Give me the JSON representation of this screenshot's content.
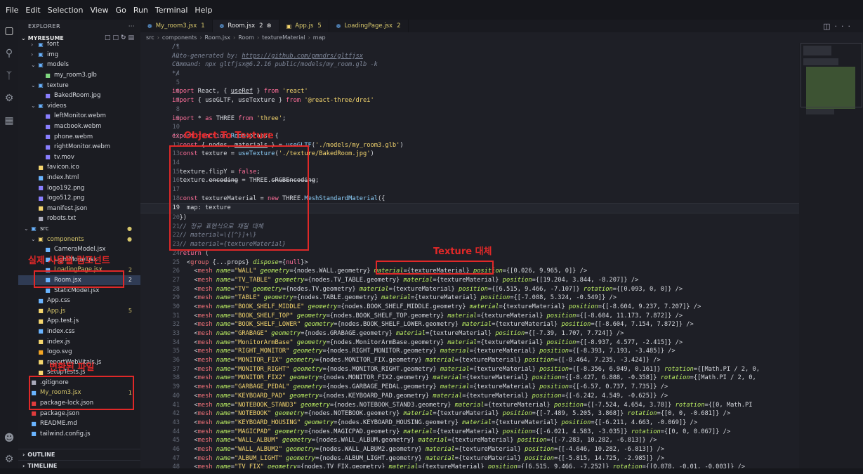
{
  "menu": [
    "File",
    "Edit",
    "Selection",
    "View",
    "Go",
    "Run",
    "Terminal",
    "Help"
  ],
  "explorer": {
    "title": "EXPLORER",
    "project": "MYRESUME",
    "tree": [
      {
        "label": "font",
        "depth": 1,
        "kind": "folder",
        "open": false,
        "color": "#6ab4ff"
      },
      {
        "label": "img",
        "depth": 1,
        "kind": "folder",
        "open": false,
        "color": "#6ab4ff"
      },
      {
        "label": "models",
        "depth": 1,
        "kind": "folder",
        "open": true,
        "color": "#6ab4ff"
      },
      {
        "label": "my_room3.glb",
        "depth": 2,
        "kind": "file",
        "color": "#7fd77f"
      },
      {
        "label": "texture",
        "depth": 1,
        "kind": "folder",
        "open": true,
        "color": "#6ab4ff"
      },
      {
        "label": "BakedRoom.jpg",
        "depth": 2,
        "kind": "file",
        "color": "#8a7fff"
      },
      {
        "label": "videos",
        "depth": 1,
        "kind": "folder",
        "open": true,
        "color": "#6ab4ff"
      },
      {
        "label": "leftMonitor.webm",
        "depth": 2,
        "kind": "file",
        "color": "#8a7fff"
      },
      {
        "label": "macbook.webm",
        "depth": 2,
        "kind": "file",
        "color": "#8a7fff"
      },
      {
        "label": "phone.webm",
        "depth": 2,
        "kind": "file",
        "color": "#8a7fff"
      },
      {
        "label": "rightMonitor.webm",
        "depth": 2,
        "kind": "file",
        "color": "#8a7fff"
      },
      {
        "label": "tv.mov",
        "depth": 2,
        "kind": "file",
        "color": "#8a7fff"
      },
      {
        "label": "favicon.ico",
        "depth": 1,
        "kind": "file",
        "color": "#f5d66e"
      },
      {
        "label": "index.html",
        "depth": 1,
        "kind": "file",
        "color": "#6ab4ff"
      },
      {
        "label": "logo192.png",
        "depth": 1,
        "kind": "file",
        "color": "#8a7fff"
      },
      {
        "label": "logo512.png",
        "depth": 1,
        "kind": "file",
        "color": "#8a7fff"
      },
      {
        "label": "manifest.json",
        "depth": 1,
        "kind": "file",
        "color": "#f5d66e"
      },
      {
        "label": "robots.txt",
        "depth": 1,
        "kind": "file",
        "color": "#aab"
      },
      {
        "label": "src",
        "depth": 0,
        "kind": "folder",
        "open": true,
        "color": "#6ab4ff",
        "dot": "#d6c66b"
      },
      {
        "label": "components",
        "depth": 1,
        "kind": "folder",
        "open": true,
        "color": "#f5d66e",
        "labelColor": "#d6c66b",
        "dot": "#d6c66b"
      },
      {
        "label": "CameraModel.jsx",
        "depth": 2,
        "kind": "file",
        "color": "#6ab4ff"
      },
      {
        "label": "LightModel.jsx",
        "depth": 2,
        "kind": "file",
        "color": "#6ab4ff"
      },
      {
        "label": "LoadingPage.jsx",
        "depth": 2,
        "kind": "file",
        "color": "#6ab4ff",
        "labelColor": "#d6c66b",
        "badge": "2",
        "badgeColor": "#d6c66b"
      },
      {
        "label": "Room.jsx",
        "depth": 2,
        "kind": "file",
        "color": "#6ab4ff",
        "selected": true,
        "badge": "2",
        "badgeColor": "#e6e6e6"
      },
      {
        "label": "StaticModel.jsx",
        "depth": 2,
        "kind": "file",
        "color": "#6ab4ff"
      },
      {
        "label": "App.css",
        "depth": 1,
        "kind": "file",
        "color": "#6ab4ff"
      },
      {
        "label": "App.js",
        "depth": 1,
        "kind": "file",
        "color": "#f5d66e",
        "labelColor": "#d6c66b",
        "badge": "5",
        "badgeColor": "#d6c66b"
      },
      {
        "label": "App.test.js",
        "depth": 1,
        "kind": "file",
        "color": "#f5d66e"
      },
      {
        "label": "index.css",
        "depth": 1,
        "kind": "file",
        "color": "#6ab4ff"
      },
      {
        "label": "index.js",
        "depth": 1,
        "kind": "file",
        "color": "#f5d66e"
      },
      {
        "label": "logo.svg",
        "depth": 1,
        "kind": "file",
        "color": "#f5a623"
      },
      {
        "label": "reportWebVitals.js",
        "depth": 1,
        "kind": "file",
        "color": "#f5d66e"
      },
      {
        "label": "setupTests.js",
        "depth": 1,
        "kind": "file",
        "color": "#f5d66e"
      },
      {
        "label": ".gitignore",
        "depth": 0,
        "kind": "file",
        "color": "#aab"
      },
      {
        "label": "My_room3.jsx",
        "depth": 0,
        "kind": "file",
        "color": "#6ab4ff",
        "labelColor": "#d6c66b",
        "badge": "1",
        "badgeColor": "#d6c66b"
      },
      {
        "label": "package-lock.json",
        "depth": 0,
        "kind": "file",
        "color": "#e03c3c"
      },
      {
        "label": "package.json",
        "depth": 0,
        "kind": "file",
        "color": "#e03c3c"
      },
      {
        "label": "README.md",
        "depth": 0,
        "kind": "file",
        "color": "#6ab4ff"
      },
      {
        "label": "tailwind.config.js",
        "depth": 0,
        "kind": "file",
        "color": "#6ab4ff"
      }
    ],
    "outline": "OUTLINE",
    "timeline": "TIMELINE"
  },
  "tabs": [
    {
      "label": "My_room3.jsx",
      "count": "1",
      "active": false
    },
    {
      "label": "Room.jsx",
      "count": "2",
      "active": true
    },
    {
      "label": "App.js",
      "count": "5",
      "active": false
    },
    {
      "label": "LoadingPage.jsx",
      "count": "2",
      "active": false
    }
  ],
  "breadcrumb": [
    "src",
    "components",
    "Room.jsx",
    "Room",
    "textureMaterial",
    "map"
  ],
  "code_lines": [
    {
      "n": "1",
      "html": "<span class='c-cmt'>/*</span>"
    },
    {
      "n": "2",
      "html": "<span class='c-cmt'>Auto-generated by: </span><span class='c-link'>https://github.com/pmndrs/gltfjsx</span>"
    },
    {
      "n": "3",
      "html": "<span class='c-cmt'>Command: npx gltfjsx@6.2.16 public/models/my_room.glb -k</span>"
    },
    {
      "n": "4",
      "html": "<span class='c-cmt'>*/</span>"
    },
    {
      "n": "5",
      "html": ""
    },
    {
      "n": "6",
      "html": "<span class='c-kw'>import</span> React, { <u>useRef</u> } <span class='c-kw'>from</span> <span class='c-str'>'react'</span>"
    },
    {
      "n": "7",
      "html": "<span class='c-kw'>import</span> { useGLTF, useTexture } <span class='c-kw'>from</span> <span class='c-str'>'@react-three/drei'</span>"
    },
    {
      "n": "8",
      "html": ""
    },
    {
      "n": "9",
      "html": "<span class='c-kw'>import</span> * <span class='c-kw'>as</span> THREE <span class='c-kw'>from</span> <span class='c-str'>'three'</span>;"
    },
    {
      "n": "10",
      "html": ""
    },
    {
      "n": "11",
      "html": "<span class='c-kw'>export function</span> <span class='c-fn'>Room</span>(props) {"
    },
    {
      "n": "12",
      "html": "  <span class='c-kw'>const</span> { nodes, <u>materials</u> } = <span class='c-fn'>useGLTF</span>(<span class='c-str'>'./models/my_room3.glb'</span>)"
    },
    {
      "n": "13",
      "html": "  <span class='c-kw'>const</span> texture = <span class='c-fn'>useTexture</span>(<span class='c-str'>'./texture/BakedRoom.jpg'</span>)"
    },
    {
      "n": "14",
      "html": ""
    },
    {
      "n": "15",
      "html": "  texture.flipY = <span class='c-kw'>false</span>;"
    },
    {
      "n": "16",
      "html": "  texture.<s>encoding</s> = THREE.<s>sRGBEncoding</s>;"
    },
    {
      "n": "17",
      "html": ""
    },
    {
      "n": "18",
      "html": "  <span class='c-kw'>const</span> textureMaterial = <span class='c-kw'>new</span> THREE.<span class='c-fn'>MeshStandardMaterial</span>({"
    },
    {
      "n": "19",
      "html": "    map: texture"
    },
    {
      "n": "20",
      "html": "  })"
    },
    {
      "n": "21",
      "html": "  <span class='c-cmt'>// 정규 표현식으로 재질 대체</span>"
    },
    {
      "n": "22",
      "html": "  <span class='c-cmt'>// material=\\{[^}]+\\}</span>"
    },
    {
      "n": "23",
      "html": "  <span class='c-cmt'>// material={textureMaterial}</span>"
    },
    {
      "n": "24",
      "html": "  <span class='c-kw'>return</span> ("
    },
    {
      "n": "25",
      "html": "    &lt;<span class='c-tag'>group</span> {...props} <span class='c-attr'>dispose</span>={<span class='c-kw'>null</span>}&gt;"
    },
    {
      "n": "26",
      "html": "      &lt;<span class='c-tag'>mesh</span> <span class='c-attr'>name</span>=<span class='c-str'>\"WALL\"</span> <span class='c-attr'>geometry</span>={nodes.WALL.geometry} <span class='c-attr'>material</span>={textureMaterial} <span class='c-attr'>position</span>={[0.026, 9.965, 0]} /&gt;"
    },
    {
      "n": "27",
      "html": "      &lt;<span class='c-tag'>mesh</span> <span class='c-attr'>name</span>=<span class='c-str'>\"TV_TABLE\"</span> <span class='c-attr'>geometry</span>={nodes.TV_TABLE.geometry} <span class='c-attr'>material</span>={textureMaterial} <span class='c-attr'>position</span>={[19.204, 3.844, -8.207]} /&gt;"
    },
    {
      "n": "28",
      "html": "      &lt;<span class='c-tag'>mesh</span> <span class='c-attr'>name</span>=<span class='c-str'>\"TV\"</span> <span class='c-attr'>geometry</span>={nodes.TV.geometry} <span class='c-attr'>material</span>={textureMaterial} <span class='c-attr'>position</span>={[6.515, 9.466, -7.107]} <span class='c-attr'>rotation</span>={[0.093, 0, 0]} /&gt;"
    },
    {
      "n": "29",
      "html": "      &lt;<span class='c-tag'>mesh</span> <span class='c-attr'>name</span>=<span class='c-str'>\"TABLE\"</span> <span class='c-attr'>geometry</span>={nodes.TABLE.geometry} <span class='c-attr'>material</span>={textureMaterial} <span class='c-attr'>position</span>={[-7.088, 5.324, -0.549]} /&gt;"
    },
    {
      "n": "30",
      "html": "      &lt;<span class='c-tag'>mesh</span> <span class='c-attr'>name</span>=<span class='c-str'>\"BOOK_SHELF_MIDDLE\"</span> <span class='c-attr'>geometry</span>={nodes.BOOK_SHELF_MIDDLE.geometry} <span class='c-attr'>material</span>={textureMaterial} <span class='c-attr'>position</span>={[-8.604, 9.237, 7.207]} /&gt;"
    },
    {
      "n": "31",
      "html": "      &lt;<span class='c-tag'>mesh</span> <span class='c-attr'>name</span>=<span class='c-str'>\"BOOK_SHELF_TOP\"</span> <span class='c-attr'>geometry</span>={nodes.BOOK_SHELF_TOP.geometry} <span class='c-attr'>material</span>={textureMaterial} <span class='c-attr'>position</span>={[-8.604, 11.173, 7.872]} /&gt;"
    },
    {
      "n": "32",
      "html": "      &lt;<span class='c-tag'>mesh</span> <span class='c-attr'>name</span>=<span class='c-str'>\"BOOK_SHELF_LOWER\"</span> <span class='c-attr'>geometry</span>={nodes.BOOK_SHELF_LOWER.geometry} <span class='c-attr'>material</span>={textureMaterial} <span class='c-attr'>position</span>={[-8.604, 7.154, 7.872]} /&gt;"
    },
    {
      "n": "33",
      "html": "      &lt;<span class='c-tag'>mesh</span> <span class='c-attr'>name</span>=<span class='c-str'>\"GRABAGE\"</span> <span class='c-attr'>geometry</span>={nodes.GRABAGE.geometry} <span class='c-attr'>material</span>={textureMaterial} <span class='c-attr'>position</span>={[-7.39, 1.707, 7.724]} /&gt;"
    },
    {
      "n": "34",
      "html": "      &lt;<span class='c-tag'>mesh</span> <span class='c-attr'>name</span>=<span class='c-str'>\"MonitorArmBase\"</span> <span class='c-attr'>geometry</span>={nodes.MonitorArmBase.geometry} <span class='c-attr'>material</span>={textureMaterial} <span class='c-attr'>position</span>={[-8.937, 4.577, -2.415]} /&gt;"
    },
    {
      "n": "35",
      "html": "      &lt;<span class='c-tag'>mesh</span> <span class='c-attr'>name</span>=<span class='c-str'>\"RIGHT_MONITOR\"</span> <span class='c-attr'>geometry</span>={nodes.RIGHT_MONITOR.geometry} <span class='c-attr'>material</span>={textureMaterial} <span class='c-attr'>position</span>={[-8.393, 7.193, -3.485]} /&gt;"
    },
    {
      "n": "36",
      "html": "      &lt;<span class='c-tag'>mesh</span> <span class='c-attr'>name</span>=<span class='c-str'>\"MONITOR_FIX\"</span> <span class='c-attr'>geometry</span>={nodes.MONITOR_FIX.geometry} <span class='c-attr'>material</span>={textureMaterial} <span class='c-attr'>position</span>={[-8.464, 7.235, -3.424]} /&gt;"
    },
    {
      "n": "37",
      "html": "      &lt;<span class='c-tag'>mesh</span> <span class='c-attr'>name</span>=<span class='c-str'>\"MONITOR_RIGHT\"</span> <span class='c-attr'>geometry</span>={nodes.MONITOR_RIGHT.geometry} <span class='c-attr'>material</span>={textureMaterial} <span class='c-attr'>position</span>={[-8.356, 6.949, 0.161]} <span class='c-attr'>rotation</span>={[Math.PI / 2, 0,"
    },
    {
      "n": "38",
      "html": "      &lt;<span class='c-tag'>mesh</span> <span class='c-attr'>name</span>=<span class='c-str'>\"MONITOR_FIX2\"</span> <span class='c-attr'>geometry</span>={nodes.MONITOR_FIX2.geometry} <span class='c-attr'>material</span>={textureMaterial} <span class='c-attr'>position</span>={[-8.427, 6.888, -0.358]} <span class='c-attr'>rotation</span>={[Math.PI / 2, 0,"
    },
    {
      "n": "39",
      "html": "      &lt;<span class='c-tag'>mesh</span> <span class='c-attr'>name</span>=<span class='c-str'>\"GARBAGE_PEDAL\"</span> <span class='c-attr'>geometry</span>={nodes.GARBAGE_PEDAL.geometry} <span class='c-attr'>material</span>={textureMaterial} <span class='c-attr'>position</span>={[-6.57, 0.737, 7.735]} /&gt;"
    },
    {
      "n": "40",
      "html": "      &lt;<span class='c-tag'>mesh</span> <span class='c-attr'>name</span>=<span class='c-str'>\"KEYBOARD_PAD\"</span> <span class='c-attr'>geometry</span>={nodes.KEYBOARD_PAD.geometry} <span class='c-attr'>material</span>={textureMaterial} <span class='c-attr'>position</span>={[-6.242, 4.549, -0.625]} /&gt;"
    },
    {
      "n": "41",
      "html": "      &lt;<span class='c-tag'>mesh</span> <span class='c-attr'>name</span>=<span class='c-str'>\"NOTEBOOK_STAND3\"</span> <span class='c-attr'>geometry</span>={nodes.NOTEBOOK_STAND3.geometry} <span class='c-attr'>material</span>={textureMaterial} <span class='c-attr'>position</span>={[-7.524, 4.654, 3.78]} <span class='c-attr'>rotation</span>={[0, Math.PI"
    },
    {
      "n": "42",
      "html": "      &lt;<span class='c-tag'>mesh</span> <span class='c-attr'>name</span>=<span class='c-str'>\"NOTEBOOK\"</span> <span class='c-attr'>geometry</span>={nodes.NOTEBOOK.geometry} <span class='c-attr'>material</span>={textureMaterial} <span class='c-attr'>position</span>={[-7.489, 5.205, 3.868]} <span class='c-attr'>rotation</span>={[0, 0, -0.681]} /&gt;"
    },
    {
      "n": "43",
      "html": "      &lt;<span class='c-tag'>mesh</span> <span class='c-attr'>name</span>=<span class='c-str'>\"KEYBOARD_HOUSING\"</span> <span class='c-attr'>geometry</span>={nodes.KEYBOARD_HOUSING.geometry} <span class='c-attr'>material</span>={textureMaterial} <span class='c-attr'>position</span>={[-6.211, 4.663, -0.069]} /&gt;"
    },
    {
      "n": "44",
      "html": "      &lt;<span class='c-tag'>mesh</span> <span class='c-attr'>name</span>=<span class='c-str'>\"MAGICPAD\"</span> <span class='c-attr'>geometry</span>={nodes.MAGICPAD.geometry} <span class='c-attr'>material</span>={textureMaterial} <span class='c-attr'>position</span>={[-6.021, 4.583, -3.035]} <span class='c-attr'>rotation</span>={[0, 0, 0.067]} /&gt;"
    },
    {
      "n": "45",
      "html": "      &lt;<span class='c-tag'>mesh</span> <span class='c-attr'>name</span>=<span class='c-str'>\"WALL_ALBUM\"</span> <span class='c-attr'>geometry</span>={nodes.WALL_ALBUM.geometry} <span class='c-attr'>material</span>={textureMaterial} <span class='c-attr'>position</span>={[-7.283, 10.282, -6.813]} /&gt;"
    },
    {
      "n": "46",
      "html": "      &lt;<span class='c-tag'>mesh</span> <span class='c-attr'>name</span>=<span class='c-str'>\"WALL_ALBUM2\"</span> <span class='c-attr'>geometry</span>={nodes.WALL_ALBUM2.geometry} <span class='c-attr'>material</span>={textureMaterial} <span class='c-attr'>position</span>={[-4.646, 10.282, -6.813]} /&gt;"
    },
    {
      "n": "47",
      "html": "      &lt;<span class='c-tag'>mesh</span> <span class='c-attr'>name</span>=<span class='c-str'>\"ALBUM_LIGHT\"</span> <span class='c-attr'>geometry</span>={nodes.ALBUM_LIGHT.geometry} <span class='c-attr'>material</span>={textureMaterial} <span class='c-attr'>position</span>={[-5.815, 14.725, -2.985]} /&gt;"
    },
    {
      "n": "48",
      "html": "      &lt;<span class='c-tag'>mesh</span> <span class='c-attr'>name</span>=<span class='c-str'>\"TV_FIX\"</span> <span class='c-attr'>geometry</span>={nodes.TV_FIX.geometry} <span class='c-attr'>material</span>={textureMaterial} <span class='c-attr'>position</span>={[6.515, 9.466, -7.252]} <span class='c-attr'>rotation</span>={[0.078, -0.01, -0.003]} /&gt;"
    }
  ],
  "annotations": {
    "object_to_texture_label": "Object To Texture",
    "texture_replace_label": "Texture 대체",
    "actual_component_label": "실제 사용될 컴포넌트",
    "converted_file_label": "변환된 파일"
  },
  "colors": {
    "accent": "#e02828",
    "selection": "#2f3b54",
    "background": "#1e1f26"
  }
}
